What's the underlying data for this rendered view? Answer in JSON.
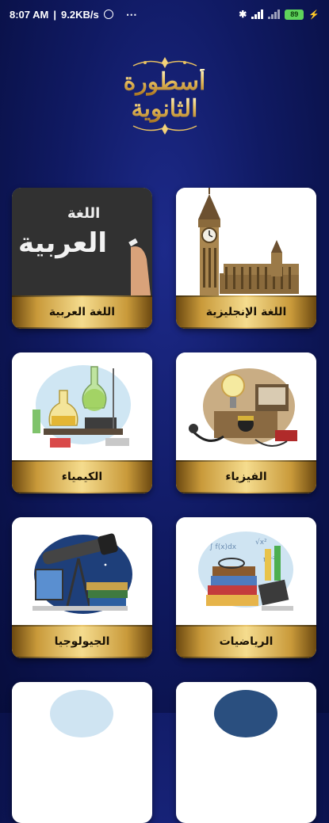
{
  "status_bar": {
    "time": "8:07 AM",
    "net_speed": "9.2KB/s",
    "battery_level": "89",
    "icons": [
      "alarm-icon",
      "more-icon",
      "bluetooth-icon",
      "signal-icon",
      "signal-icon",
      "battery-icon",
      "charging-icon"
    ]
  },
  "logo": {
    "line1": "أسطورة",
    "line2": "الثانوية"
  },
  "subjects": [
    {
      "label": "اللغة الإنجليزية",
      "icon": "big-ben-image"
    },
    {
      "label": "اللغة العربية",
      "icon": "chalkboard-image",
      "image_text_line1": "اللغة",
      "image_text_line2": "العربية"
    },
    {
      "label": "الفيزياء",
      "icon": "physics-lab-image"
    },
    {
      "label": "الكيمياء",
      "icon": "chemistry-lab-image"
    },
    {
      "label": "الرياضيات",
      "icon": "math-books-image"
    },
    {
      "label": "الجيولوجيا",
      "icon": "telescope-image"
    }
  ],
  "colors": {
    "background": "#101a63",
    "gold": "#e8c060",
    "card": "#ffffff"
  }
}
